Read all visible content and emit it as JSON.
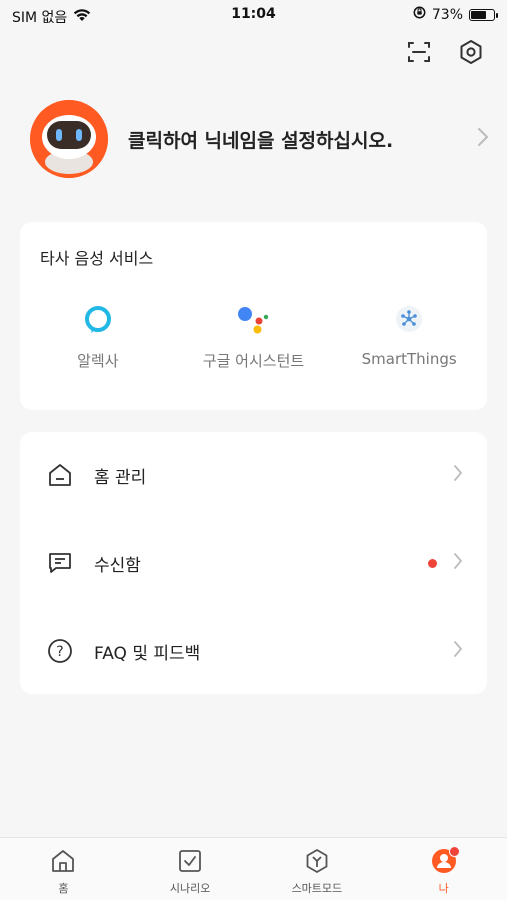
{
  "status_bar": {
    "carrier": "SIM 없음",
    "time": "11:04",
    "battery_percent": "73%",
    "battery_level": 0.73
  },
  "top_actions": {
    "icons": [
      "scan-icon",
      "settings-icon"
    ]
  },
  "profile": {
    "nickname_prompt": "클릭하여 닉네임을 설정하십시오."
  },
  "voice_services": {
    "title": "타사 음성 서비스",
    "items": [
      {
        "label": "알렉사",
        "icon": "alexa-icon"
      },
      {
        "label": "구글 어시스턴트",
        "icon": "google-assistant-icon"
      },
      {
        "label": "SmartThings",
        "icon": "smartthings-icon"
      }
    ]
  },
  "menu": {
    "items": [
      {
        "label": "홈 관리",
        "icon": "home-outline-icon",
        "has_dot": false
      },
      {
        "label": "수신함",
        "icon": "message-icon",
        "has_dot": true
      },
      {
        "label": "FAQ 및 피드백",
        "icon": "help-icon",
        "has_dot": false
      }
    ]
  },
  "tabbar": {
    "accent": "#ff5a22",
    "tabs": [
      {
        "label": "홈",
        "icon": "home-icon",
        "active": false
      },
      {
        "label": "시나리오",
        "icon": "scenario-icon",
        "active": false
      },
      {
        "label": "스마트모드",
        "icon": "smartmode-icon",
        "active": false
      },
      {
        "label": "나",
        "icon": "me-icon",
        "active": true,
        "badge": true
      }
    ]
  }
}
